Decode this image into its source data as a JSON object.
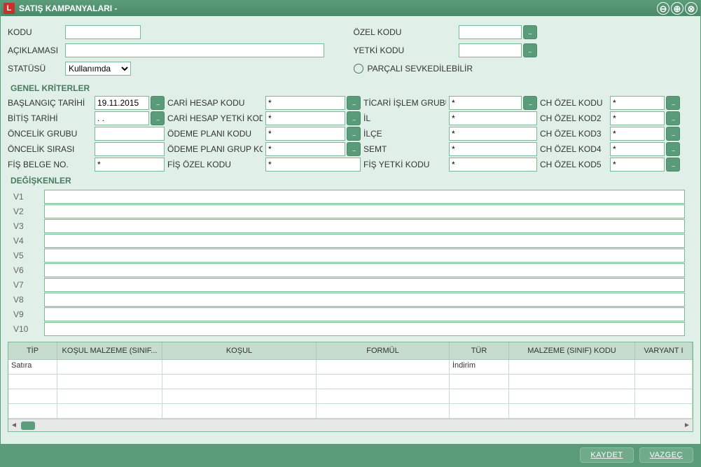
{
  "window": {
    "title": "SATIŞ KAMPANYALARI -",
    "logo_text": "L"
  },
  "top": {
    "kodu_label": "KODU",
    "kodu_value": "",
    "aciklama_label": "AÇIKLAMASI",
    "aciklama_value": "",
    "statu_label": "STATÜSÜ",
    "statu_value": "Kullanımda",
    "ozel_kodu_label": "ÖZEL KODU",
    "ozel_kodu_value": "",
    "yetki_kodu_label": "YETKİ KODU",
    "yetki_kodu_value": "",
    "parcali_label": "PARÇALI SEVKEDİLEBİLİR"
  },
  "sections": {
    "genel_kriterler": "GENEL KRİTERLER",
    "degiskenler": "DEĞİŞKENLER"
  },
  "criteria": {
    "rows": [
      {
        "c1": "BAŞLANGIÇ TARİHİ",
        "v1": "19.11.2015",
        "b1": true,
        "c2": "CARİ HESAP KODU",
        "v2": "*",
        "b2": true,
        "c3": "TİCARİ İŞLEM GRUBU",
        "v3": "*",
        "b3": true,
        "c4": "CH ÖZEL KODU",
        "v4": "*",
        "b4": true
      },
      {
        "c1": "BİTİŞ TARİHİ",
        "v1": ". .",
        "b1": true,
        "c2": "CARİ HESAP YETKİ KODU",
        "v2": "*",
        "b2": true,
        "c3": "İL",
        "v3": "*",
        "b3": false,
        "c4": "CH ÖZEL KOD2",
        "v4": "*",
        "b4": true
      },
      {
        "c1": "ÖNCELİK GRUBU",
        "v1": "",
        "b1": false,
        "c2": "ÖDEME PLANI KODU",
        "v2": "*",
        "b2": true,
        "c3": "İLÇE",
        "v3": "*",
        "b3": false,
        "c4": "CH ÖZEL KOD3",
        "v4": "*",
        "b4": true
      },
      {
        "c1": "ÖNCELİK SIRASI",
        "v1": "",
        "b1": false,
        "c2": "ÖDEME PLANI GRUP KODU",
        "v2": "*",
        "b2": true,
        "c3": "SEMT",
        "v3": "*",
        "b3": false,
        "c4": "CH ÖZEL KOD4",
        "v4": "*",
        "b4": true
      },
      {
        "c1": "FİŞ BELGE NO.",
        "v1": "*",
        "b1": false,
        "c2": "FİŞ ÖZEL KODU",
        "v2": "*",
        "b2": false,
        "c3": "FİŞ YETKİ KODU",
        "v3": "*",
        "b3": false,
        "c4": "CH ÖZEL KOD5",
        "v4": "*",
        "b4": true
      }
    ]
  },
  "vars": [
    "V1",
    "V2",
    "V3",
    "V4",
    "V5",
    "V6",
    "V7",
    "V8",
    "V9",
    "V10"
  ],
  "grid": {
    "headers": [
      "TİP",
      "KOŞUL MALZEME (SINIF...",
      "KOŞUL",
      "FORMÜL",
      "TÜR",
      "MALZEME (SINIF) KODU",
      "VARYANT I"
    ],
    "rows": [
      {
        "tip": "Satıra",
        "kosulm": "",
        "kosul": "",
        "formul": "",
        "tur": "İndirim",
        "malzeme": "",
        "varyant": ""
      },
      {
        "tip": "",
        "kosulm": "",
        "kosul": "",
        "formul": "",
        "tur": "",
        "malzeme": "",
        "varyant": ""
      },
      {
        "tip": "",
        "kosulm": "",
        "kosul": "",
        "formul": "",
        "tur": "",
        "malzeme": "",
        "varyant": ""
      },
      {
        "tip": "",
        "kosulm": "",
        "kosul": "",
        "formul": "",
        "tur": "",
        "malzeme": "",
        "varyant": ""
      }
    ]
  },
  "footer": {
    "save": "KAYDET",
    "cancel": "VAZGEÇ"
  },
  "lookup_dots": "..."
}
